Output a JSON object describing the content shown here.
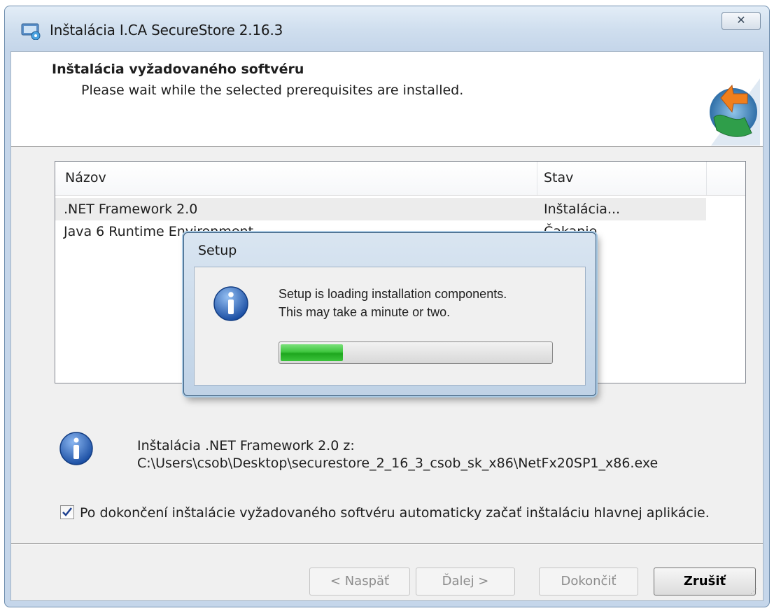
{
  "window": {
    "title": "Inštalácia I.CA SecureStore 2.16.3",
    "close_glyph": "✕"
  },
  "banner": {
    "title": "Inštalácia vyžadovaného softvéru",
    "subtitle": "Please wait while the selected prerequisites are installed."
  },
  "list": {
    "headers": {
      "name": "Názov",
      "status": "Stav"
    },
    "rows": [
      {
        "name": ".NET Framework 2.0",
        "status": "Inštalácia..."
      },
      {
        "name": "Java 6 Runtime Environment",
        "status": "Čakanie"
      }
    ]
  },
  "info": {
    "line1": "Inštalácia .NET Framework 2.0 z:",
    "line2": "C:\\Users\\csob\\Desktop\\securestore_2_16_3_csob_sk_x86\\NetFx20SP1_x86.exe"
  },
  "auto_start": {
    "checked": true,
    "label": "Po dokončení inštalácie vyžadovaného softvéru automaticky začať inštaláciu hlavnej aplikácie."
  },
  "buttons": {
    "back": "< Naspäť",
    "next": "Ďalej >",
    "finish": "Dokončiť",
    "cancel": "Zrušiť"
  },
  "setup_dialog": {
    "title": "Setup",
    "line1": "Setup is loading installation components.",
    "line2": "This may take a minute or two.",
    "progress_fraction": 0.23
  },
  "icons": {
    "app": "installer-icon",
    "info": "info-icon",
    "logo": "ica-logo"
  },
  "colors": {
    "progress_green": "#2fb52f",
    "info_blue": "#1e56b0"
  }
}
